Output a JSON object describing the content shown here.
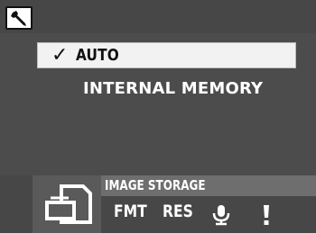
{
  "header": {
    "settings_icon": "wrench-icon"
  },
  "menu": {
    "items": [
      {
        "label": "AUTO",
        "selected": true,
        "check_icon": "checkmark-icon"
      },
      {
        "label": "INTERNAL MEMORY",
        "selected": false
      }
    ]
  },
  "footer": {
    "section_icon": "memory-card-storage-icon",
    "caption": "IMAGE STORAGE",
    "tabs": [
      {
        "label": "FMT"
      },
      {
        "label": "RES"
      },
      {
        "icon": "microphone-icon"
      },
      {
        "icon": "exclamation-icon"
      }
    ]
  },
  "colors": {
    "background": "#4c4c4c",
    "highlight": "#f2f2f2",
    "caption_bar": "#6e6e6e",
    "text": "#ffffff"
  }
}
